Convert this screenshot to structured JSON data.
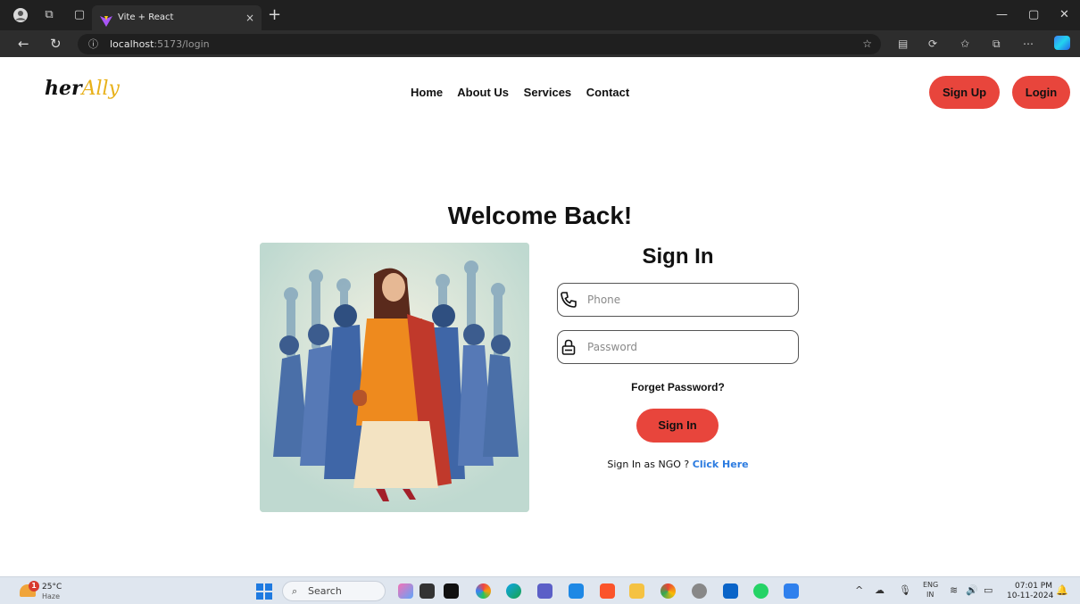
{
  "browser": {
    "tab_title": "Vite + React",
    "tab_close": "×",
    "new_tab": "+",
    "url_host": "localhost",
    "url_path": ":5173/login"
  },
  "site": {
    "logo_her": "her",
    "logo_ally": "Ally",
    "nav": [
      "Home",
      "About Us",
      "Services",
      "Contact"
    ],
    "signup_label": "Sign Up",
    "login_label": "Login",
    "welcome": "Welcome Back!"
  },
  "form": {
    "title": "Sign In",
    "phone_placeholder": "Phone",
    "password_placeholder": "Password",
    "forget": "Forget Password?",
    "submit": "Sign In",
    "ngo_text": "Sign In as NGO ?",
    "ngo_link": "Click Here"
  },
  "taskbar": {
    "weather_badge": "1",
    "temperature": "25°C",
    "condition": "Haze",
    "search_label": "Search",
    "lang1": "ENG",
    "lang2": "IN",
    "time": "07:01 PM",
    "date": "10-11-2024"
  },
  "colors": {
    "accent_red": "#e8453c",
    "link_blue": "#2b7be0",
    "logo_gold": "#e8b11a"
  }
}
